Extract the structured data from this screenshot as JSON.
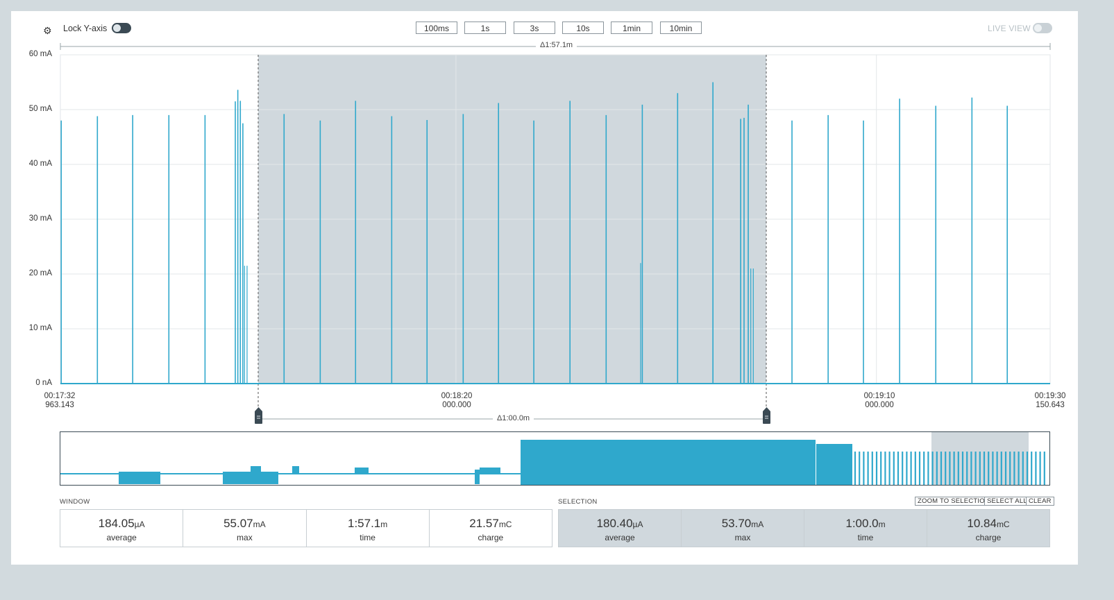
{
  "toolbar": {
    "lock_label": "Lock Y-axis",
    "lock_on": true,
    "time_buttons": [
      "100ms",
      "1s",
      "3s",
      "10s",
      "1min",
      "10min"
    ],
    "live_label": "LIVE VIEW",
    "live_on": false
  },
  "chart": {
    "window_delta": "Δ1:57.1m",
    "selection_delta": "Δ1:00.0m",
    "y_ticks": [
      "60 mA",
      "50 mA",
      "40 mA",
      "30 mA",
      "20 mA",
      "10 mA",
      "0 nA"
    ],
    "x_ticks": [
      {
        "time": "00:17:32",
        "ms": "963.143"
      },
      {
        "time": "00:18:20",
        "ms": "000.000"
      },
      {
        "time": "00:19:10",
        "ms": "000.000"
      },
      {
        "time": "00:19:30",
        "ms": "150.643"
      }
    ]
  },
  "chart_data": {
    "type": "line",
    "ylabel": "",
    "ylim_mA": [
      0,
      60
    ],
    "y_ticks_mA": [
      0,
      10,
      20,
      30,
      40,
      50,
      60
    ],
    "x_range_s": [
      0,
      117.7
    ],
    "selection_s": [
      20.5,
      80.5
    ],
    "series": [
      {
        "spike_times_s": [
          0.1,
          4.4,
          8.6,
          12.9,
          17.2,
          20.8,
          21.1,
          21.4,
          21.7,
          26.6,
          30.9,
          35.1,
          39.4,
          43.6,
          47.9,
          52.1,
          56.3,
          60.6,
          64.9,
          69.2,
          73.4,
          77.6,
          80.9,
          81.3,
          81.8,
          87.0,
          91.3,
          95.5,
          99.8,
          104.1,
          108.4,
          112.6
        ],
        "spike_peaks_mA": [
          48,
          48.8,
          49,
          49,
          49,
          51.5,
          53.6,
          51.6,
          47.5,
          49.2,
          48,
          51.6,
          48.8,
          48.1,
          49.2,
          51.2,
          48,
          51.6,
          49,
          50.9,
          53,
          55,
          48.3,
          48.5,
          50.9,
          48,
          49,
          48,
          52,
          50.7,
          52.2,
          50.7
        ]
      }
    ]
  },
  "overview": {
    "trace_color": "#2fa8cc"
  },
  "window": {
    "label": "WINDOW",
    "stats": [
      {
        "value": "184.05",
        "unit": "µA",
        "label": "average"
      },
      {
        "value": "55.07",
        "unit": "mA",
        "label": "max"
      },
      {
        "value": "1:57.1",
        "unit": "m",
        "label": "time"
      },
      {
        "value": "21.57",
        "unit": "mC",
        "label": "charge"
      }
    ]
  },
  "selection": {
    "label": "SELECTION",
    "buttons": [
      "ZOOM TO SELECTION",
      "SELECT ALL",
      "CLEAR"
    ],
    "stats": [
      {
        "value": "180.40",
        "unit": "µA",
        "label": "average"
      },
      {
        "value": "53.70",
        "unit": "mA",
        "label": "max"
      },
      {
        "value": "1:00.0",
        "unit": "m",
        "label": "time"
      },
      {
        "value": "10.84",
        "unit": "mC",
        "label": "charge"
      }
    ]
  },
  "colors": {
    "trace": "#2fa8cc",
    "selection_fill": "#d0d8dd",
    "background": "#d2dade",
    "toggle_on": "#3b4a54"
  }
}
